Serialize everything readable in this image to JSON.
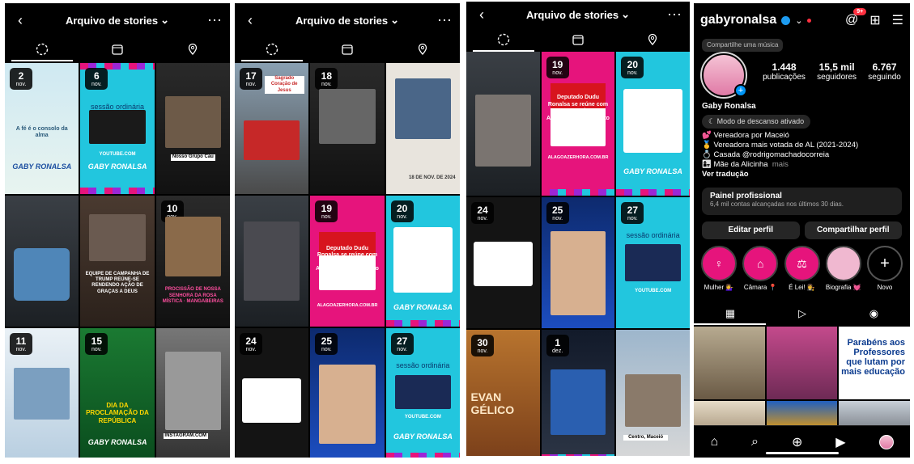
{
  "archive": {
    "title": "Arquivo de stories",
    "panels": [
      {
        "cells": [
          {
            "day": "2",
            "month": "nov.",
            "text": "A fé é o consolo da alma",
            "logo": "GABY RONALSA"
          },
          {
            "day": "6",
            "month": "nov.",
            "label": "sessão ordinária",
            "text": "YOUTUBE.COM",
            "logo": "GABY RONALSA"
          },
          {
            "day": "",
            "month": "",
            "text": "Nosso Grupo Cáu"
          },
          {
            "day": "",
            "month": "",
            "text": ""
          },
          {
            "day": "",
            "month": "",
            "text": "EQUIPE DE CAMPANHA DE TRUMP REÚNE-SE RENDENDO AÇÃO DE GRAÇAS A DEUS"
          },
          {
            "day": "10",
            "month": "nov.",
            "text": "PROCISSÃO DE NOSSA SENHORA DA ROSA MÍSTICA · MANGABEIRAS"
          },
          {
            "day": "11",
            "month": "nov.",
            "text": ""
          },
          {
            "day": "15",
            "month": "nov.",
            "text": "DIA DA PROCLAMAÇÃO DA REPÚBLICA",
            "logo": "GABY RONALSA"
          },
          {
            "day": "",
            "month": "",
            "text": "INSTAGRAM.COM"
          }
        ]
      },
      {
        "cells": [
          {
            "day": "17",
            "month": "nov.",
            "text": "Sagrado Coração de Jesus"
          },
          {
            "day": "18",
            "month": "nov.",
            "text": ""
          },
          {
            "day": "",
            "month": "",
            "text": "18 DE NOV. DE 2024"
          },
          {
            "day": "",
            "month": "",
            "text": ""
          },
          {
            "day": "19",
            "month": "nov.",
            "text": "Deputado Dudu Ronalsa se reúne com o governador e o Arcebispo Dom Alberto Breis",
            "sub": "ALAGOAZERHORA.COM.BR"
          },
          {
            "day": "20",
            "month": "nov.",
            "text": "",
            "logo": "GABY RONALSA"
          },
          {
            "day": "24",
            "month": "nov.",
            "text": ""
          },
          {
            "day": "25",
            "month": "nov.",
            "text": ""
          },
          {
            "day": "27",
            "month": "nov.",
            "label": "sessão ordinária",
            "text": "YOUTUBE.COM",
            "logo": "GABY RONALSA"
          }
        ]
      },
      {
        "cells": [
          {
            "day": "",
            "month": "",
            "text": ""
          },
          {
            "day": "19",
            "month": "nov.",
            "text": "Deputado Dudu Ronalsa se reúne com o governador e o Arcebispo Dom Alberto Breis",
            "sub": "ALAGOAZERHORA.COM.BR"
          },
          {
            "day": "20",
            "month": "nov.",
            "text": "",
            "logo": "GABY RONALSA"
          },
          {
            "day": "24",
            "month": "nov.",
            "text": ""
          },
          {
            "day": "25",
            "month": "nov.",
            "text": ""
          },
          {
            "day": "27",
            "month": "nov.",
            "label": "sessão ordinária",
            "text": "YOUTUBE.COM"
          },
          {
            "day": "30",
            "month": "nov.",
            "text": "EVAN GÉLICO"
          },
          {
            "day": "1",
            "month": "dez.",
            "text": ""
          },
          {
            "day": "",
            "month": "",
            "text": "Centro, Maceió"
          }
        ]
      }
    ]
  },
  "profile": {
    "username": "gabyronalsa",
    "notif_count": "9+",
    "tooltip": "Compartilhe uma música",
    "stats": [
      {
        "value": "1.448",
        "label": "publicações"
      },
      {
        "value": "15,5 mil",
        "label": "seguidores"
      },
      {
        "value": "6.767",
        "label": "seguindo"
      }
    ],
    "name": "Gaby Ronalsa",
    "rest_mode": "Modo de descanso ativado",
    "bio_lines": [
      "💕 Vereadora por Maceió",
      "🥇 Vereadora mais votada de AL (2021-2024)",
      "💍 Casada @rodrigomachadocorreia",
      "👩‍👧 Mãe da Alicinha"
    ],
    "bio_more": "mais",
    "translate": "Ver tradução",
    "pro_title": "Painel profissional",
    "pro_sub": "6,4 mil contas alcançadas nos últimos 30 dias.",
    "edit_button": "Editar perfil",
    "share_button": "Compartilhar perfil",
    "highlights": [
      {
        "label": "Mulher 💁‍♀️"
      },
      {
        "label": "Câmara 📍"
      },
      {
        "label": "É Lei! 👩‍⚖️"
      },
      {
        "label": "Biografia 💓"
      },
      {
        "label": "Novo"
      }
    ],
    "post_text": "Parabéns aos Professores que lutam por mais educação"
  }
}
